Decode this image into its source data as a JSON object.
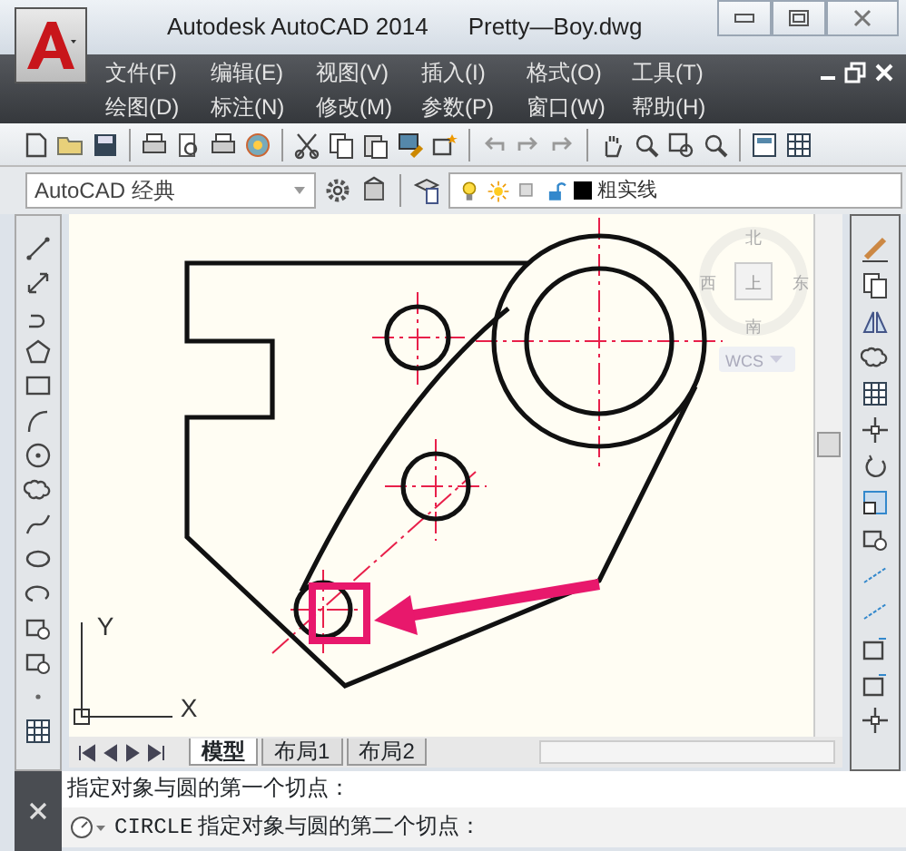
{
  "window": {
    "app_title": "Autodesk AutoCAD 2014",
    "document": "Pretty—Boy.dwg"
  },
  "menu_rows": [
    [
      "文件(F)",
      "编辑(E)",
      "视图(V)",
      "插入(I)",
      "格式(O)",
      "工具(T)"
    ],
    [
      "绘图(D)",
      "标注(N)",
      "修改(M)",
      "参数(P)",
      "窗口(W)",
      "帮助(H)"
    ]
  ],
  "workspace": {
    "value": "AutoCAD 经典"
  },
  "layer": {
    "name": "粗实线",
    "color": "#000000"
  },
  "viewcube": {
    "north": "北",
    "east": "东",
    "south": "南",
    "west": "西",
    "face": "上",
    "ucs_menu": "WCS"
  },
  "ucs_icon": {
    "x_label": "X",
    "y_label": "Y"
  },
  "layout_tabs": [
    {
      "label": "模型",
      "selected": true
    },
    {
      "label": "布局1",
      "selected": false
    },
    {
      "label": "布局2",
      "selected": false
    }
  ],
  "command_history": [
    "指定对象与圆的第一个切点："
  ],
  "command_prompt": {
    "command": "CIRCLE",
    "text": "指定对象与圆的第二个切点："
  }
}
